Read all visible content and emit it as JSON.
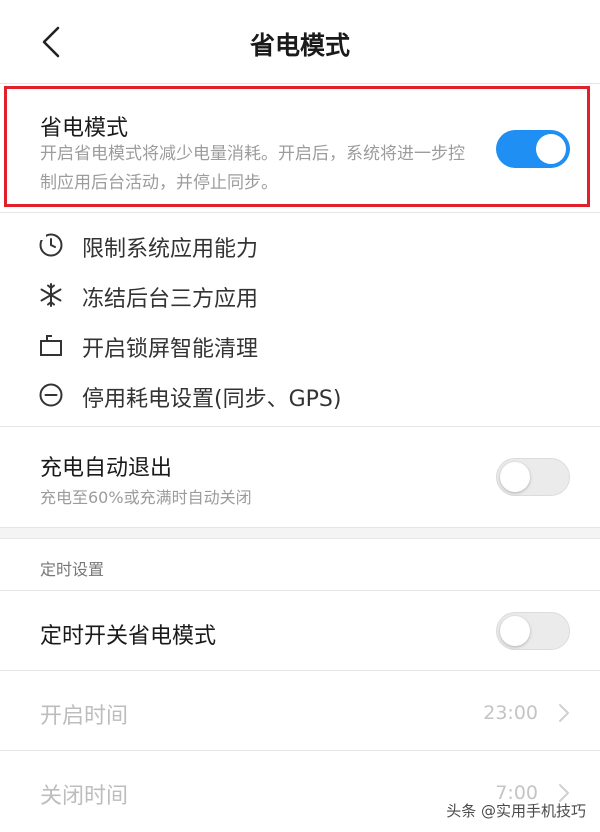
{
  "header": {
    "title": "省电模式"
  },
  "power_saving": {
    "title": "省电模式",
    "description": "开启省电模式将减少电量消耗。开启后，系统将进一步控制应用后台活动，并停止同步。",
    "enabled": true
  },
  "features": [
    {
      "label": "限制系统应用能力",
      "icon": "clock-icon"
    },
    {
      "label": "冻结后台三方应用",
      "icon": "snowflake-icon"
    },
    {
      "label": "开启锁屏智能清理",
      "icon": "briefcase-icon"
    },
    {
      "label": "停用耗电设置(同步、GPS)",
      "icon": "minus-circle-icon"
    }
  ],
  "charge_exit": {
    "title": "充电自动退出",
    "subtitle": "充电至60%或充满时自动关闭",
    "enabled": false
  },
  "schedule": {
    "section_label": "定时设置",
    "toggle": {
      "title": "定时开关省电模式",
      "enabled": false
    },
    "start": {
      "label": "开启时间",
      "value": "23:00"
    },
    "end": {
      "label": "关闭时间",
      "value": "7:00"
    }
  },
  "watermark": "头条 @实用手机技巧",
  "colors": {
    "accent": "#1f8ff3",
    "highlight_border": "#e0202a"
  }
}
